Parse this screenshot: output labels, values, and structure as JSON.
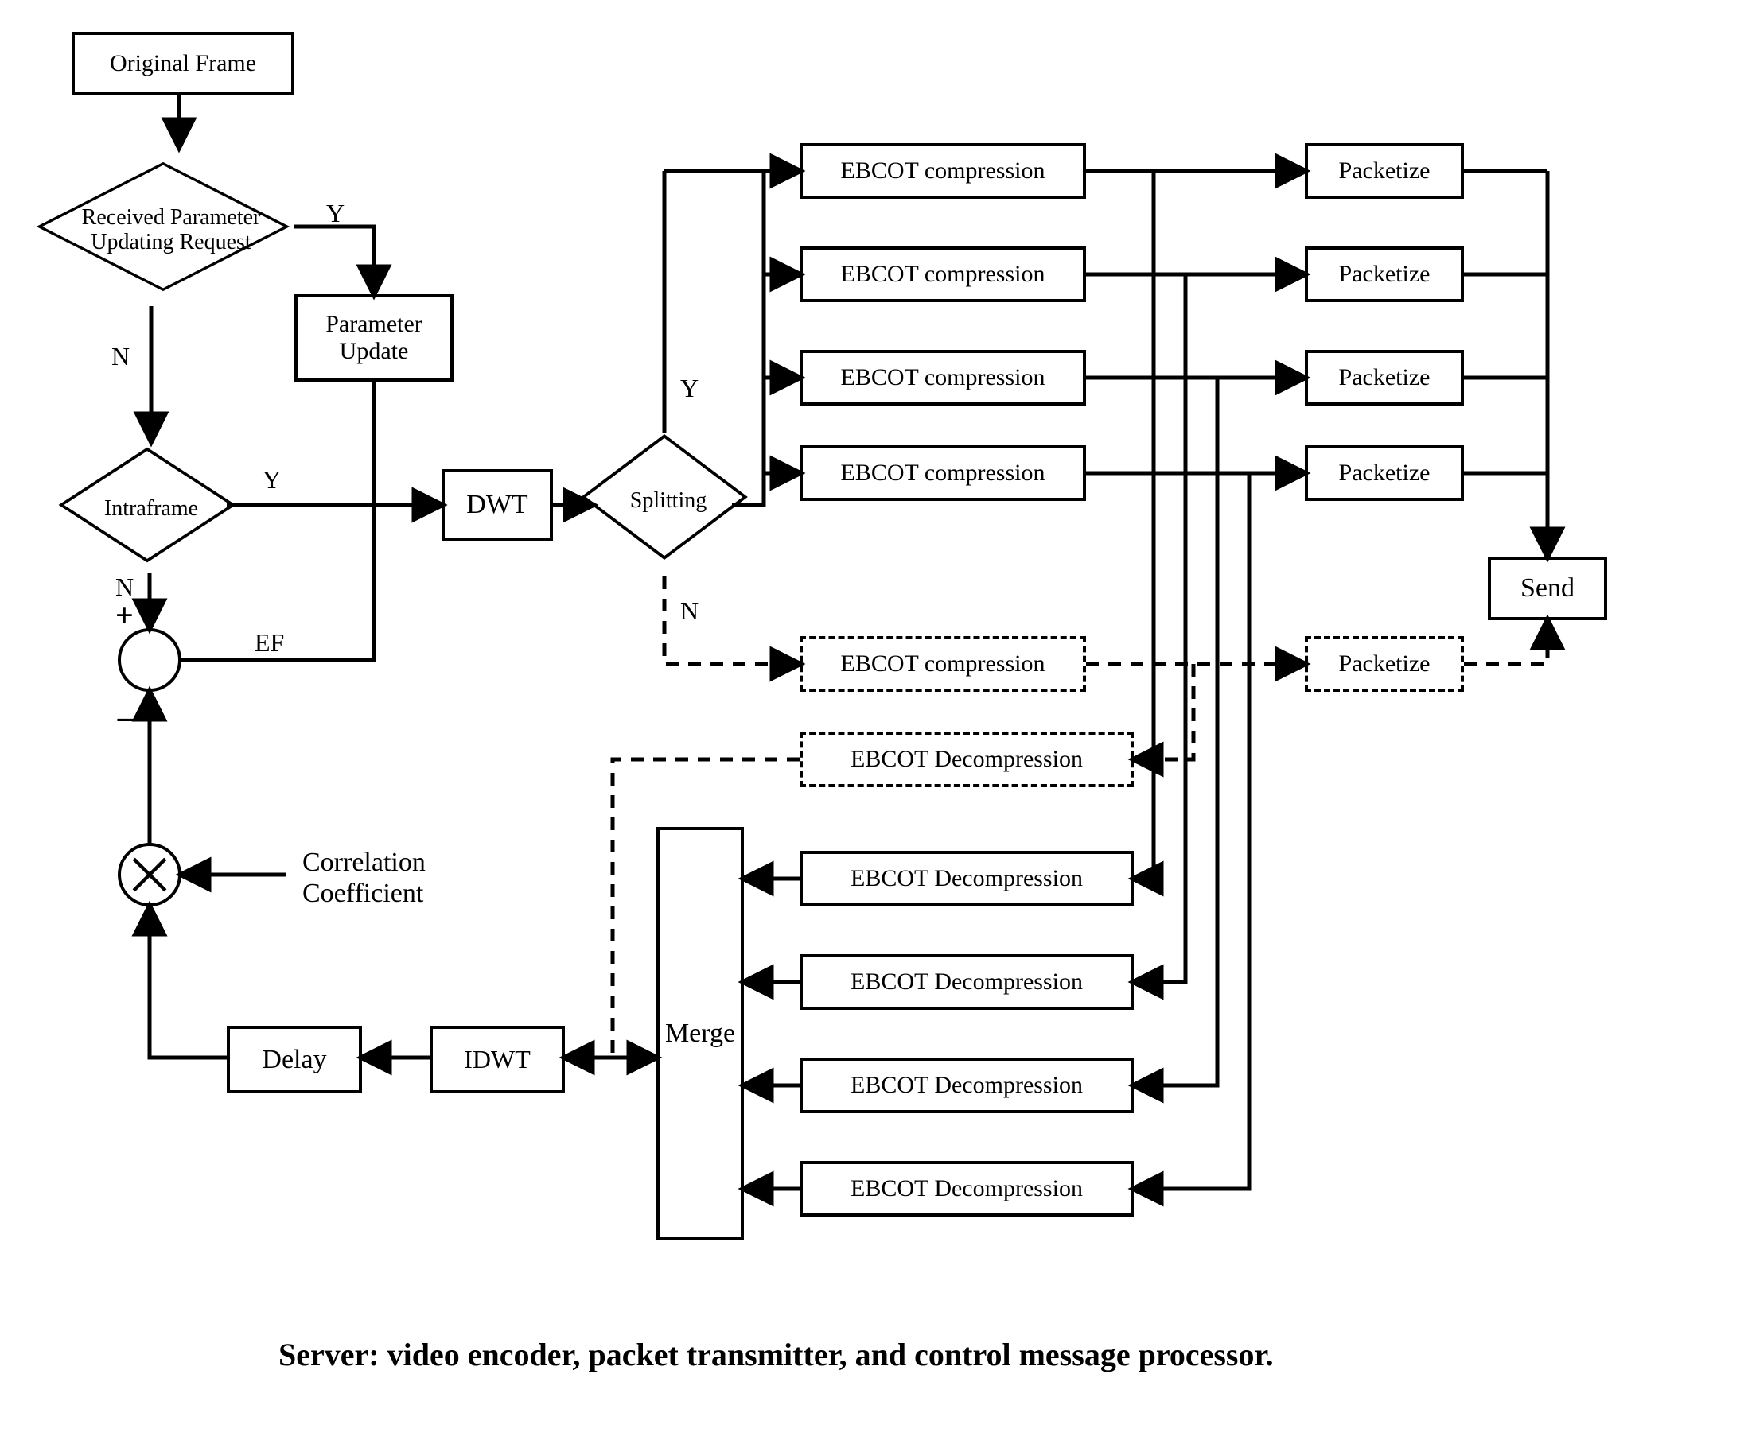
{
  "caption": "Server: video encoder, packet transmitter, and control message processor.",
  "nodes": {
    "original_frame": "Original Frame",
    "param_decision": "Received Parameter\nUpdating Request",
    "param_update": "Parameter\nUpdate",
    "intraframe": "Intraframe",
    "dwt": "DWT",
    "splitting": "Splitting",
    "ebcot_comp": "EBCOT compression",
    "packetize": "Packetize",
    "send": "Send",
    "ebcot_decomp": "EBCOT Decompression",
    "merge": "Merge",
    "idwt": "IDWT",
    "delay": "Delay",
    "correlation": "Correlation\nCoefficient"
  },
  "edge_labels": {
    "Y": "Y",
    "N": "N",
    "EF": "EF",
    "plus": "+",
    "minus": "−"
  }
}
